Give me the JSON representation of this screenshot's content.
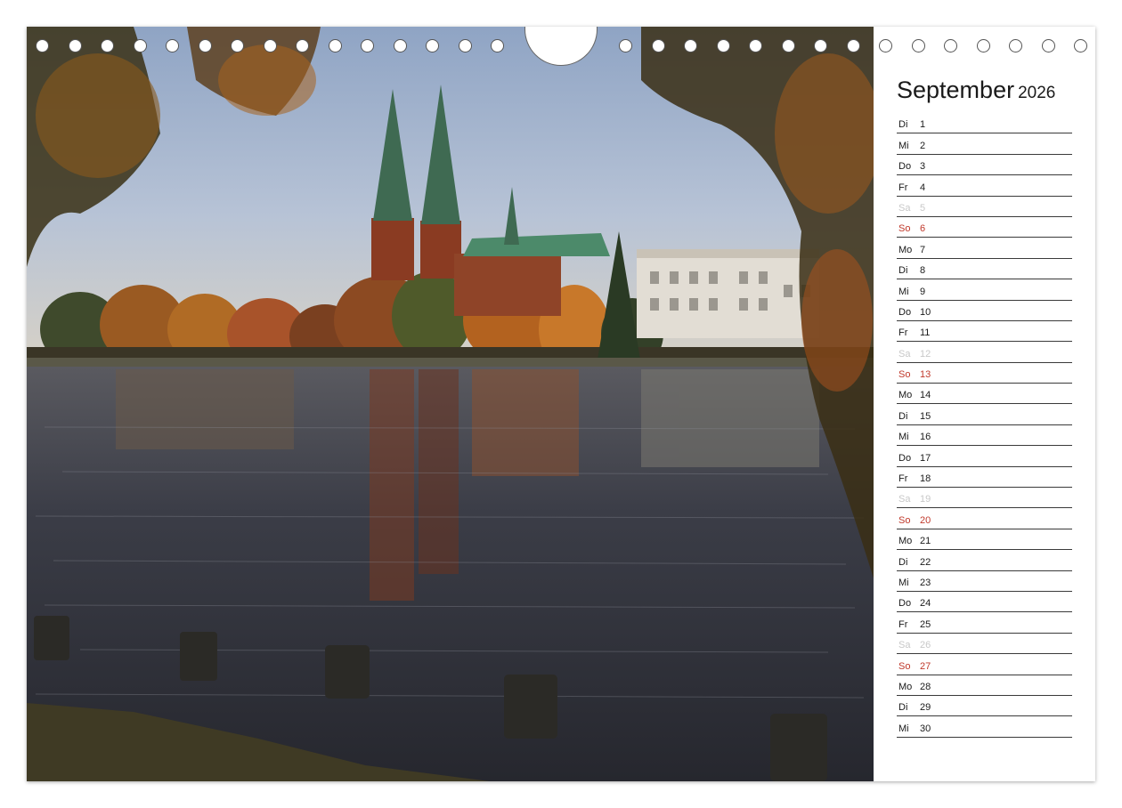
{
  "calendar": {
    "month": "September",
    "year": "2026",
    "days": [
      {
        "wd": "Di",
        "d": "1",
        "type": "weekday"
      },
      {
        "wd": "Mi",
        "d": "2",
        "type": "weekday"
      },
      {
        "wd": "Do",
        "d": "3",
        "type": "weekday"
      },
      {
        "wd": "Fr",
        "d": "4",
        "type": "weekday"
      },
      {
        "wd": "Sa",
        "d": "5",
        "type": "saturday"
      },
      {
        "wd": "So",
        "d": "6",
        "type": "sunday"
      },
      {
        "wd": "Mo",
        "d": "7",
        "type": "weekday"
      },
      {
        "wd": "Di",
        "d": "8",
        "type": "weekday"
      },
      {
        "wd": "Mi",
        "d": "9",
        "type": "weekday"
      },
      {
        "wd": "Do",
        "d": "10",
        "type": "weekday"
      },
      {
        "wd": "Fr",
        "d": "11",
        "type": "weekday"
      },
      {
        "wd": "Sa",
        "d": "12",
        "type": "saturday"
      },
      {
        "wd": "So",
        "d": "13",
        "type": "sunday"
      },
      {
        "wd": "Mo",
        "d": "14",
        "type": "weekday"
      },
      {
        "wd": "Di",
        "d": "15",
        "type": "weekday"
      },
      {
        "wd": "Mi",
        "d": "16",
        "type": "weekday"
      },
      {
        "wd": "Do",
        "d": "17",
        "type": "weekday"
      },
      {
        "wd": "Fr",
        "d": "18",
        "type": "weekday"
      },
      {
        "wd": "Sa",
        "d": "19",
        "type": "saturday"
      },
      {
        "wd": "So",
        "d": "20",
        "type": "sunday"
      },
      {
        "wd": "Mo",
        "d": "21",
        "type": "weekday"
      },
      {
        "wd": "Di",
        "d": "22",
        "type": "weekday"
      },
      {
        "wd": "Mi",
        "d": "23",
        "type": "weekday"
      },
      {
        "wd": "Do",
        "d": "24",
        "type": "weekday"
      },
      {
        "wd": "Fr",
        "d": "25",
        "type": "weekday"
      },
      {
        "wd": "Sa",
        "d": "26",
        "type": "saturday"
      },
      {
        "wd": "So",
        "d": "27",
        "type": "sunday"
      },
      {
        "wd": "Mo",
        "d": "28",
        "type": "weekday"
      },
      {
        "wd": "Di",
        "d": "29",
        "type": "weekday"
      },
      {
        "wd": "Mi",
        "d": "30",
        "type": "weekday"
      }
    ]
  },
  "colors": {
    "sunday": "#c0392b",
    "saturday": "#c8c8c8",
    "text": "#1a1a1a",
    "sky": "#aab8d0",
    "water": "#3a3c48",
    "brick": "#8a3b22",
    "copper_roof": "#4c8a6a",
    "foliage": "#b8621f"
  },
  "photo": {
    "subject": "cathedral-with-twin-spires-over-lake"
  }
}
